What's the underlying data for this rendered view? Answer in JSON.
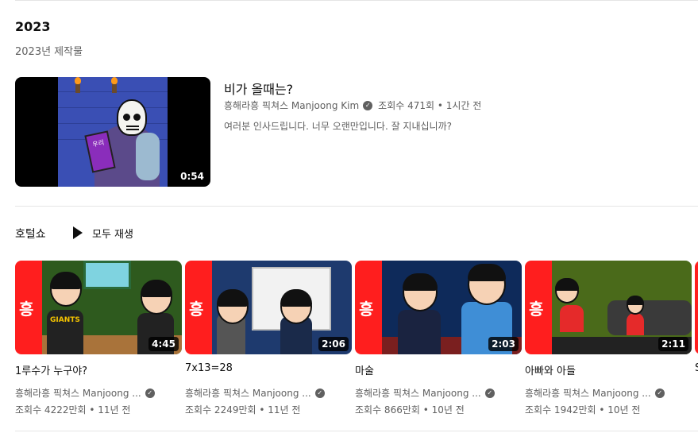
{
  "section": {
    "year": "2023",
    "subtitle": "2023년 제작물"
  },
  "featured": {
    "title": "비가 올때는?",
    "channel": "흥해라흥 픽쳐스 Manjoong Kim",
    "stats": "조회수 471회 • 1시간 전",
    "description": "여러분 인사드립니다. 너무 오랜만입니다. 잘 지내십니까?",
    "duration": "0:54",
    "book_text": "우리"
  },
  "shelf": {
    "title": "호털쇼",
    "play_all": "모두 재생",
    "videos": [
      {
        "title": "1루수가 누구야?",
        "channel": "흥해라흥 픽쳐스 Manjoong ...",
        "stats": "조회수 4222만회 • 11년 전",
        "duration": "4:45",
        "shirt_text": "GIANTS"
      },
      {
        "title": "7x13=28",
        "channel": "흥해라흥 픽쳐스 Manjoong ...",
        "stats": "조회수 2249만회 • 11년 전",
        "duration": "2:06"
      },
      {
        "title": "마술",
        "channel": "흥해라흥 픽쳐스 Manjoong ...",
        "stats": "조회수 866만회 • 10년 전",
        "duration": "2:03"
      },
      {
        "title": "아빠와 아들",
        "channel": "흥해라흥 픽쳐스 Manjoong ...",
        "stats": "조회수 1942만회 • 10년 전",
        "duration": "2:11"
      }
    ],
    "partial_title": "S"
  },
  "icons": {
    "verified": "checkmark-verified-icon",
    "play": "play-icon",
    "brand_glyph": "흥"
  }
}
